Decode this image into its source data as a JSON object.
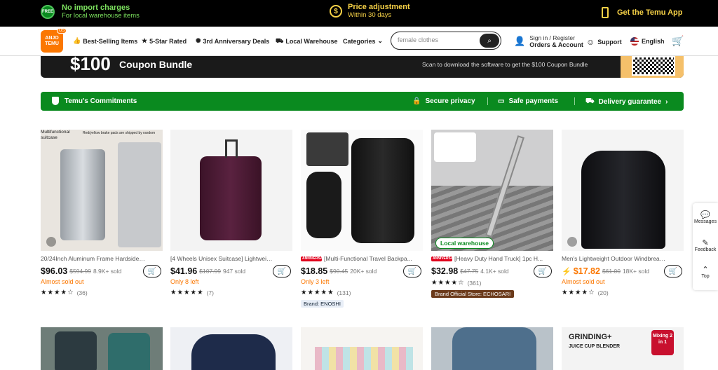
{
  "topbar": {
    "free_badge": "FREE",
    "import_title": "No import charges",
    "import_sub": "For local warehouse items",
    "price_title": "Price adjustment",
    "price_sub": "Within 30 days",
    "app_label": "Get the Temu App"
  },
  "nav": {
    "logo_top": "ANJO",
    "logo_bottom": "TEMU",
    "logo_region": "US",
    "items": [
      "Best-Selling Items",
      "5-Star Rated",
      "3rd Anniversary Deals",
      "Local Warehouse",
      "Categories"
    ],
    "search_value": "female clothes",
    "sign_in": "Sign in / Register",
    "orders": "Orders & Account",
    "support": "Support",
    "language": "English"
  },
  "coupon": {
    "amount": "$100",
    "label": "Coupon Bundle",
    "scan_text": "Scan to download the software to get the $100 Coupon Bundle"
  },
  "commitments": {
    "title": "Temu's Commitments",
    "items": [
      "Secure privacy",
      "Safe payments",
      "Delivery guarantee"
    ]
  },
  "products": [
    {
      "title": "20/24Inch Aluminum Frame Hardside Spin...",
      "price": "$96.03",
      "orig": "$594.99",
      "sold": "8.9K+ sold",
      "status": "Almost sold out",
      "stars": "★★★★☆",
      "reviews": "(36)",
      "img_text1": "Multifunctional suitcase",
      "img_text2": "Red/yellow brake pads are shipped by random"
    },
    {
      "title": "[4 Wheels Unisex Suitcase] Lightweight Oxf...",
      "price": "$41.96",
      "orig": "$107.99",
      "sold": "947 sold",
      "status": "Only 8 left",
      "stars": "★★★★★",
      "reviews": "(7)"
    },
    {
      "title": "[Multi-Functional Travel Backpa...",
      "price": "$18.85",
      "orig": "$90.45",
      "sold": "20K+ sold",
      "status": "Only 3 left",
      "stars": "★★★★★",
      "reviews": "(131)",
      "badge": "ANNIVERSARY DEALS",
      "tag": "Brand: ENOSHI"
    },
    {
      "title": "[Heavy Duty Hand Truck] 1pc H...",
      "price": "$32.98",
      "orig": "$47.75",
      "sold": "4.1K+ sold",
      "status": "",
      "stars": "★★★★☆",
      "reviews": "(361)",
      "badge": "ANNIVERSARY DEALS",
      "tag": "Brand Official Store: ECHOSARI",
      "local": "Local warehouse"
    },
    {
      "title": "Men's Lightweight Outdoor Windbreaker J...",
      "price": "$17.82",
      "orig": "$61.00",
      "sold": "18K+ sold",
      "status": "Almost sold out",
      "stars": "★★★★☆",
      "reviews": "(20)"
    }
  ],
  "bottom_cards": {
    "grinding": "GRINDING+",
    "juice": "JUICE CUP BLENDER",
    "mixing": "Mixing 2 in 1"
  },
  "side": {
    "messages": "Messages",
    "feedback": "Feedback",
    "top": "Top"
  }
}
